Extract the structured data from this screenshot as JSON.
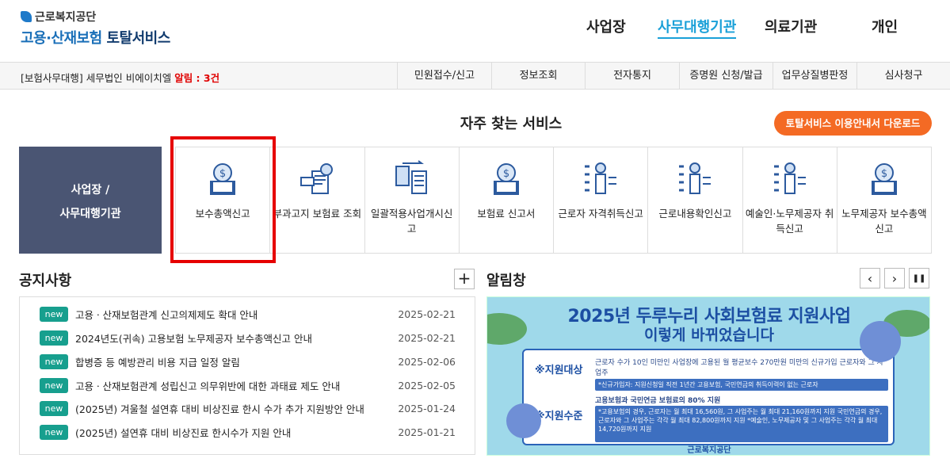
{
  "header": {
    "org_name": "근로복지공단",
    "service_name_blue": "고용·산재보험",
    "service_name_dark": "토탈서비스",
    "nav": [
      "사업장",
      "사무대행기관",
      "의료기관",
      "개인"
    ],
    "active_nav": "사무대행기관"
  },
  "subbar": {
    "office_label": "[보험사무대행] 세무법인 비에이치엘",
    "alert_label": "알림 : 3건",
    "menu": [
      "민원접수/신고",
      "정보조회",
      "전자통지",
      "증명원 신청/발급",
      "업무상질병판정",
      "심사청구"
    ]
  },
  "favorites": {
    "title": "자주 찾는 서비스",
    "guide_button": "토탈서비스 이용안내서 다운로드",
    "category_line1": "사업장 /",
    "category_line2": "사무대행기관",
    "items": [
      {
        "label": "보수총액신고",
        "icon": "money-document-icon"
      },
      {
        "label": "부과고지 보험료 조회",
        "icon": "receipt-search-icon"
      },
      {
        "label": "일괄적용사업개시신고",
        "icon": "document-transfer-icon"
      },
      {
        "label": "보험료 신고서",
        "icon": "money-document-icon"
      },
      {
        "label": "근로자 자격취득신고",
        "icon": "person-checklist-icon"
      },
      {
        "label": "근로내용확인신고",
        "icon": "person-checklist-icon"
      },
      {
        "label": "예술인·노무제공자 취득신고",
        "icon": "person-checklist-icon"
      },
      {
        "label": "노무제공자 보수총액신고",
        "icon": "money-document-icon"
      }
    ],
    "highlight_color": "#e60000"
  },
  "notices": {
    "title": "공지사항",
    "more_label": "+",
    "badge": "new",
    "items": [
      {
        "text": "고용ㆍ산재보험관계 신고의제제도 확대 안내",
        "date": "2025-02-21"
      },
      {
        "text": "2024년도(귀속) 고용보험 노무제공자 보수총액신고 안내",
        "date": "2025-02-21"
      },
      {
        "text": "합병증 등 예방관리 비용 지급 일정 알림",
        "date": "2025-02-06"
      },
      {
        "text": "고용ㆍ산재보험관계 성립신고 의무위반에 대한 과태료 제도 안내",
        "date": "2025-02-05"
      },
      {
        "text": "(2025년) 겨울철 설연휴 대비 비상진료 한시 수가 추가 지원방안 안내",
        "date": "2025-01-24"
      },
      {
        "text": "(2025년) 설연휴 대비 비상진료 한시수가 지원 안내",
        "date": "2025-01-21"
      }
    ]
  },
  "alarm": {
    "title": "알림창",
    "prev": "‹",
    "next": "›",
    "pause": "❚❚",
    "banner": {
      "title1": "2025년 두루누리 사회보험료 지원사업",
      "title2": "이렇게 바뀌었습니다",
      "label1": "※지원대상",
      "text1": "근로자 수가 10인 미만인 사업장에 고용된 월 평균보수 270만원 미만의 신규가입 근로자와 그 사업주",
      "note1": "*신규가입자: 지원신청일 직전 1년간 고용보험, 국민연금의 취득이력이 없는 근로자",
      "label2": "※지원수준",
      "text2": "고용보험과 국민연금 보험료의 80% 지원",
      "note2": "*고용보험의 경우, 근로자는 월 최대 16,560원, 그 사업주는 월 최대 21,160원까지 지원 국민연금의 경우, 근로자와 그 사업주는 각각 월 최대 82,800원까지 지원 *예술인, 노무제공자 및 그 사업주는 각각 월 최대 14,720원까지 지원",
      "footer": "근로복지공단"
    }
  }
}
